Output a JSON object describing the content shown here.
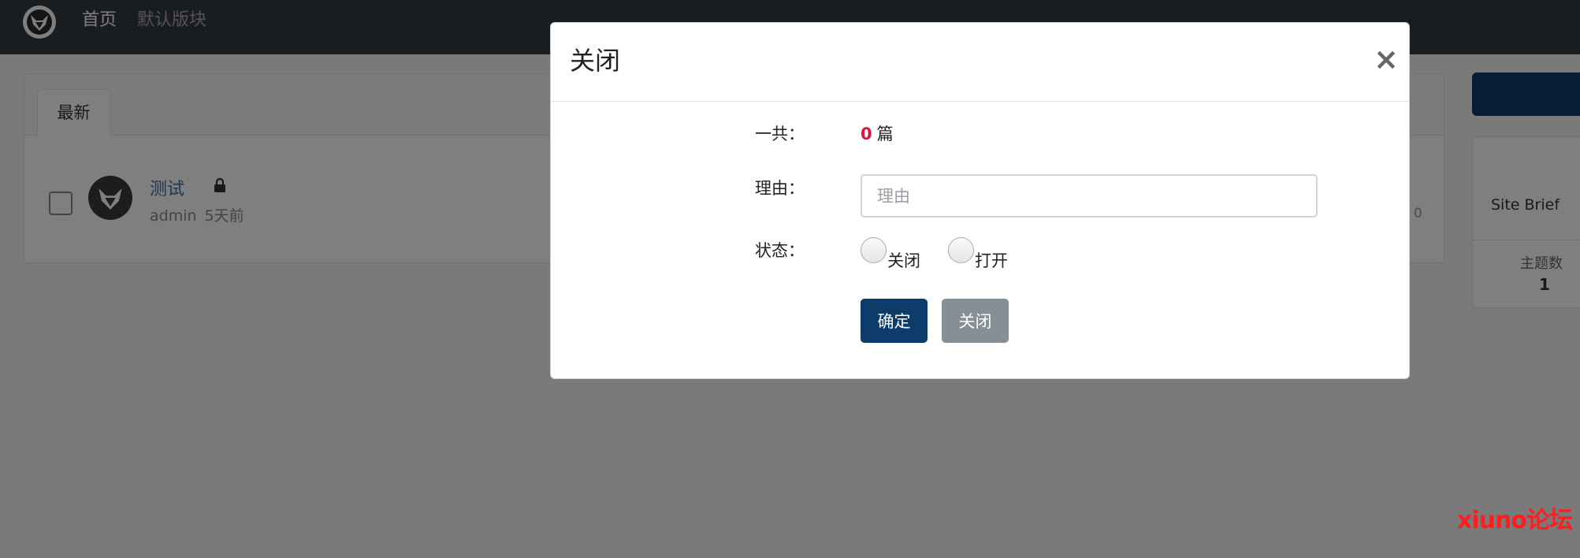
{
  "nav": {
    "home": "首页",
    "forum": "默认版块"
  },
  "threads": {
    "tab_latest": "最新",
    "item": {
      "title": "测试",
      "author": "admin",
      "time": "5天前",
      "count": "0"
    }
  },
  "sidebar": {
    "brief": "Site Brief",
    "stat_label": "主题数",
    "stat_value": "1"
  },
  "modal": {
    "title": "关闭",
    "close_symbol": "×",
    "total_label": "一共：",
    "total_count": "0",
    "total_unit": "篇",
    "reason_label": "理由：",
    "reason_placeholder": "理由",
    "reason_value": "",
    "status_label": "状态：",
    "status_options": [
      "关闭",
      "打开"
    ],
    "confirm_label": "确定",
    "cancel_label": "关闭"
  },
  "watermark": "xiuno论坛",
  "colors": {
    "navbar": "#343a40",
    "primary": "#0d3c6a",
    "secondary": "#868e96",
    "count_red": "#dc143c",
    "link": "#3d6fa3"
  },
  "icons": {
    "logo": "horned-mask-logo-icon",
    "lock": "lock-icon",
    "close": "close-icon"
  }
}
